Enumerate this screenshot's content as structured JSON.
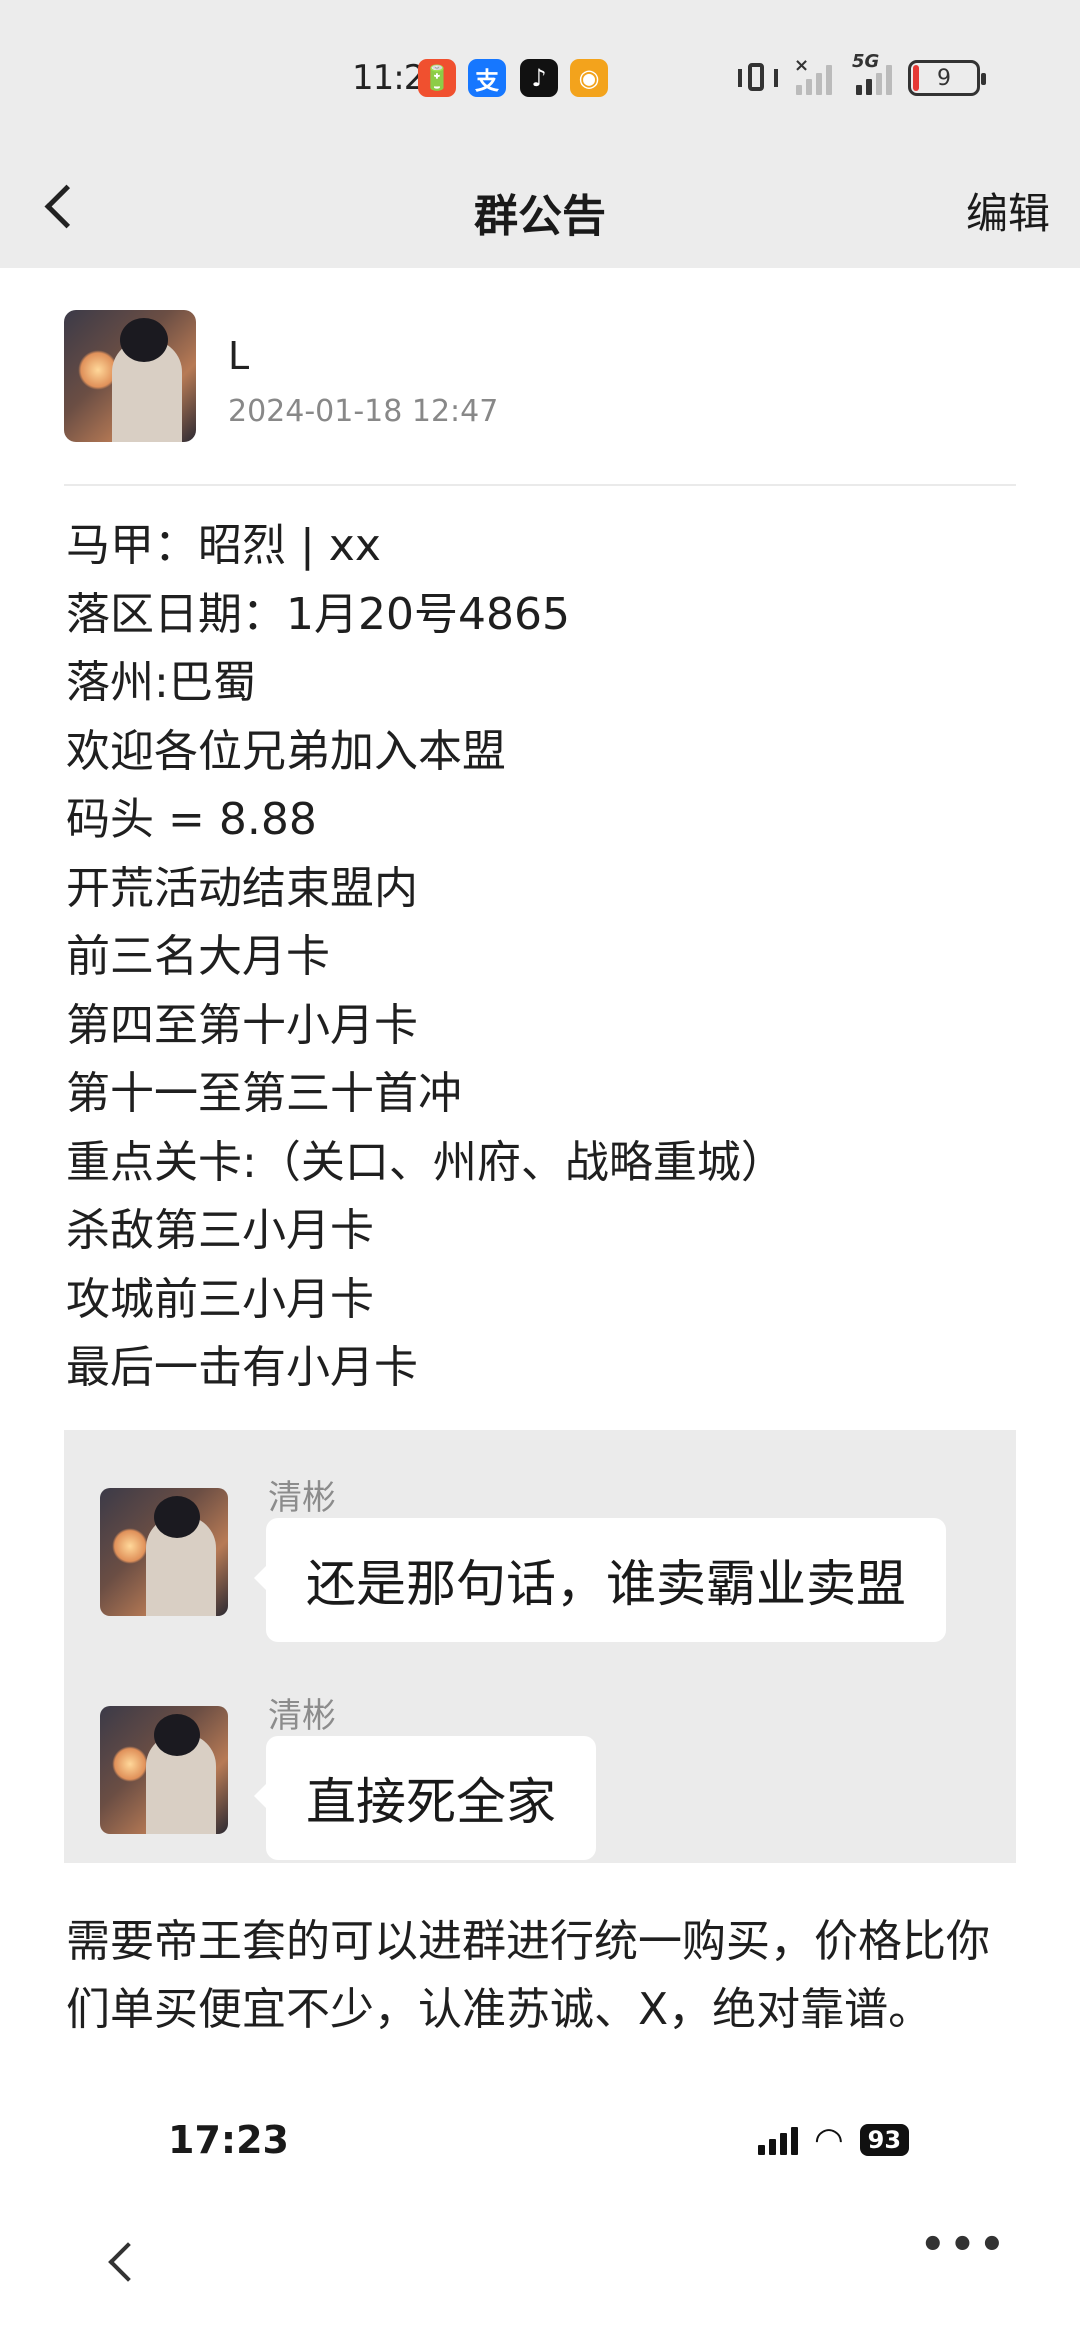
{
  "status_bar": {
    "time": "11:24",
    "app_icons": [
      "🔋",
      "支",
      "♪",
      "◉"
    ],
    "network": "5G",
    "battery": "9"
  },
  "header": {
    "title": "群公告",
    "edit_label": "编辑"
  },
  "author": {
    "name": "L",
    "timestamp": "2024-01-18 12:47"
  },
  "announcement_lines": [
    "马甲：昭烈 | xx",
    "落区日期：1月20号4865",
    "落州:巴蜀",
    "欢迎各位兄弟加入本盟",
    "码头 = 8.88",
    "开荒活动结束盟内",
    "前三名大月卡",
    "第四至第十小月卡",
    "第十一至第三十首冲",
    "重点关卡:（关口、州府、战略重城）",
    "杀敌第三小月卡",
    "攻城前三小月卡",
    "最后一击有小月卡"
  ],
  "chat_screenshot": {
    "messages": [
      {
        "sender": "清彬",
        "text": "还是那句话，谁卖霸业卖盟"
      },
      {
        "sender": "清彬",
        "text": "直接死全家"
      }
    ]
  },
  "tail_paragraph": "需要帝王套的可以进群进行统一购买，价格比你们单买便宜不少，认准苏诚、X，绝对靠谱。",
  "embedded_status_bar": {
    "time": "17:23",
    "battery": "93"
  },
  "icons": {
    "back": "chevron-left-icon",
    "more": "more-dots-icon"
  }
}
